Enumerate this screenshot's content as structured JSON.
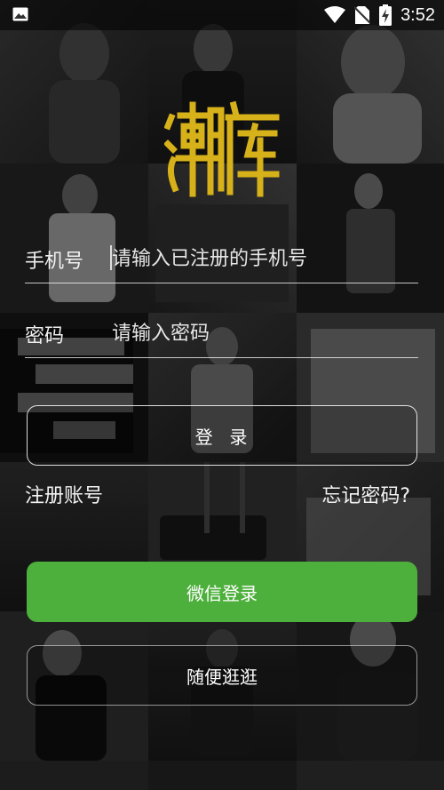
{
  "status_bar": {
    "time": "3:52",
    "icons": [
      "image-icon",
      "wifi-icon",
      "no-sim-icon",
      "battery-charging-icon"
    ]
  },
  "logo_text": "潮库",
  "form": {
    "phone_label": "手机号",
    "phone_placeholder": "请输入已注册的手机号",
    "password_label": "密码",
    "password_placeholder": "请输入密码"
  },
  "buttons": {
    "login": "登  录",
    "wechat_login": "微信登录",
    "browse": "随便逛逛"
  },
  "links": {
    "register": "注册账号",
    "forgot_password": "忘记密码?"
  },
  "colors": {
    "logo": "#d6b11a",
    "wechat_green": "#4eb03c"
  }
}
